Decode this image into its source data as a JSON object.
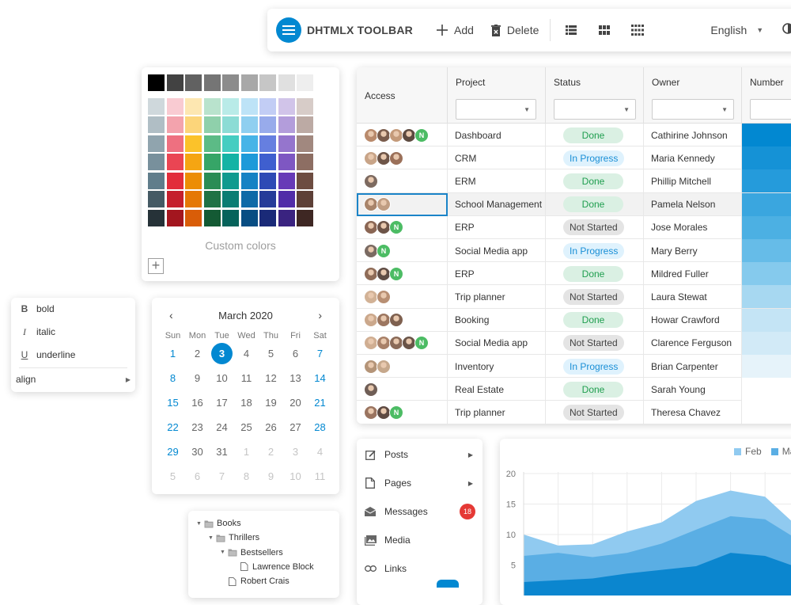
{
  "toolbar": {
    "title": "DHTMLX TOOLBAR",
    "add_label": "Add",
    "delete_label": "Delete",
    "language": "English"
  },
  "color_picker": {
    "grays": [
      "#000000",
      "#424242",
      "#616161",
      "#757575",
      "#8c8c8c",
      "#a8a8a8",
      "#c6c6c6",
      "#e0e0e0",
      "#eeeeee"
    ],
    "palette": [
      [
        "#cfd8dc",
        "#f9cbd2",
        "#fde7b1",
        "#b9e3cd",
        "#b9ebe8",
        "#bde3f7",
        "#c2cdf5",
        "#d1c4e9",
        "#d7ccc8"
      ],
      [
        "#b0bec5",
        "#f3a3ad",
        "#fcd57a",
        "#8fd0ab",
        "#8cdcd5",
        "#8fcff0",
        "#98abeb",
        "#b39ddb",
        "#bcaaa4"
      ],
      [
        "#90a4ae",
        "#ee7080",
        "#fbc22a",
        "#5cbb86",
        "#45cdc1",
        "#47b4e7",
        "#667fe0",
        "#9575cd",
        "#a1887f"
      ],
      [
        "#78909c",
        "#ea4553",
        "#f5a512",
        "#36a567",
        "#14b3a5",
        "#1e9ad9",
        "#3f5fcf",
        "#7e57c2",
        "#8d6e63"
      ],
      [
        "#607d8b",
        "#e22d3b",
        "#ec8d04",
        "#2a8c55",
        "#0f9a8e",
        "#1582c4",
        "#2e4ab5",
        "#673ab7",
        "#6d4c41"
      ],
      [
        "#455a64",
        "#c51f2d",
        "#e57805",
        "#1f7245",
        "#0a7d73",
        "#0e6aa7",
        "#263c99",
        "#512da8",
        "#5d4037"
      ],
      [
        "#263238",
        "#a3161f",
        "#d95d08",
        "#145a34",
        "#06635b",
        "#084d83",
        "#1a2a78",
        "#3a2380",
        "#3e2723"
      ]
    ],
    "custom_label": "Custom colors",
    "add_symbol": "+"
  },
  "menu": {
    "items": [
      {
        "icon": "B",
        "label": "bold"
      },
      {
        "icon": "I",
        "label": "italic"
      },
      {
        "icon": "U",
        "label": "underline"
      }
    ],
    "align_label": "align"
  },
  "calendar": {
    "month_label": "March 2020",
    "prev": "‹",
    "next": "›",
    "weekdays": [
      "Sun",
      "Mon",
      "Tue",
      "Wed",
      "Thu",
      "Fri",
      "Sat"
    ],
    "weeks": [
      [
        "1",
        "2",
        "3",
        "4",
        "5",
        "6",
        "7"
      ],
      [
        "8",
        "9",
        "10",
        "11",
        "12",
        "13",
        "14"
      ],
      [
        "15",
        "16",
        "17",
        "18",
        "19",
        "20",
        "21"
      ],
      [
        "22",
        "23",
        "24",
        "25",
        "26",
        "27",
        "28"
      ],
      [
        "29",
        "30",
        "31",
        "1",
        "2",
        "3",
        "4"
      ],
      [
        "5",
        "6",
        "7",
        "8",
        "9",
        "10",
        "11"
      ]
    ],
    "selected": "3"
  },
  "tree": {
    "items": [
      {
        "label": "Books",
        "type": "folder",
        "level": 0,
        "open": true
      },
      {
        "label": "Thrillers",
        "type": "folder",
        "level": 1,
        "open": true
      },
      {
        "label": "Bestsellers",
        "type": "folder",
        "level": 2,
        "open": true
      },
      {
        "label": "Lawrence Block",
        "type": "file",
        "level": 3
      },
      {
        "label": "Robert Crais",
        "type": "file",
        "level": 2
      }
    ]
  },
  "grid": {
    "columns": [
      "Access",
      "Project",
      "Status",
      "Owner",
      "Number"
    ],
    "rows": [
      {
        "avatars": [
          "#b98a6c",
          "#7a5c4c",
          "#c49a7a",
          "#5d4a40"
        ],
        "n": true,
        "project": "Dashboard",
        "status": "Done",
        "owner": "Cathirine Johnson",
        "number_color": "#0288d1"
      },
      {
        "avatars": [
          "#c8a488",
          "#6e5548",
          "#9b7059"
        ],
        "n": false,
        "project": "CRM",
        "status": "In Progress",
        "owner": "Maria Kennedy",
        "number_color": "#1592d6"
      },
      {
        "avatars": [
          "#7d6a60"
        ],
        "n": false,
        "project": "ERM",
        "status": "Done",
        "owner": "Phillip Mitchell",
        "number_color": "#259bdb"
      },
      {
        "avatars": [
          "#a8846a",
          "#c09d82"
        ],
        "n": false,
        "project": "School Management",
        "status": "Done",
        "owner": "Pamela Nelson",
        "number_color": "#3aa6df"
      },
      {
        "avatars": [
          "#8a6654",
          "#6d5448"
        ],
        "n": true,
        "project": "ERP",
        "status": "Not Started",
        "owner": "Jose Morales",
        "number_color": "#4cb0e3"
      },
      {
        "avatars": [
          "#7a6a62"
        ],
        "n": true,
        "project": "Social Media app",
        "status": "In Progress",
        "owner": "Mary Berry",
        "number_color": "#66bce8"
      },
      {
        "avatars": [
          "#8f6c58",
          "#5f4c44"
        ],
        "n": true,
        "project": "ERP",
        "status": "Done",
        "owner": "Mildred Fuller",
        "number_color": "#85caed"
      },
      {
        "avatars": [
          "#d2b296",
          "#b88f73"
        ],
        "n": false,
        "project": "Trip planner",
        "status": "Not Started",
        "owner": "Laura Stewat",
        "number_color": "#a7d8f1"
      },
      {
        "avatars": [
          "#cba88c",
          "#9c7660",
          "#7e604f"
        ],
        "n": false,
        "project": "Booking",
        "status": "Done",
        "owner": "Howar Crawford",
        "number_color": "#c4e4f5"
      },
      {
        "avatars": [
          "#d0ae92",
          "#a88068",
          "#8a6a58",
          "#6a5448"
        ],
        "n": true,
        "project": "Social Media app",
        "status": "Not Started",
        "owner": "Clarence Ferguson",
        "number_color": "#d2eaf7"
      },
      {
        "avatars": [
          "#b49478",
          "#c6a88c"
        ],
        "n": false,
        "project": "Inventory",
        "status": "In Progress",
        "owner": "Brian Carpenter",
        "number_color": "#e6f3fa"
      },
      {
        "avatars": [
          "#6f5e56"
        ],
        "n": false,
        "project": "Real Estate",
        "status": "Done",
        "owner": "Sarah Young",
        "number_color": "#ffffff"
      },
      {
        "avatars": [
          "#9a7460",
          "#5e4a42"
        ],
        "n": true,
        "project": "Trip planner",
        "status": "Not Started",
        "owner": "Theresa Chavez",
        "number_color": "#ffffff"
      }
    ],
    "n_label": "N"
  },
  "sidebar": {
    "items": [
      {
        "icon": "edit-icon",
        "label": "Posts",
        "arrow": true
      },
      {
        "icon": "page-icon",
        "label": "Pages",
        "arrow": true
      },
      {
        "icon": "message-icon",
        "label": "Messages",
        "count": "18"
      },
      {
        "icon": "image-icon",
        "label": "Media"
      },
      {
        "icon": "link-icon",
        "label": "Links"
      }
    ]
  },
  "chart_data": {
    "type": "area",
    "title": "",
    "ylim": [
      0,
      20
    ],
    "yticks": [
      "20",
      "15",
      "10",
      "5"
    ],
    "series": [
      {
        "name": "Feb",
        "color": "#90caf0",
        "values": [
          10,
          8.2,
          8.4,
          10.5,
          12,
          15.5,
          17.2,
          16.2,
          11
        ]
      },
      {
        "name": "Ma",
        "color": "#5aaee4",
        "values": [
          6.5,
          7,
          6.3,
          7,
          8.5,
          10.8,
          13,
          12.5,
          9
        ]
      },
      {
        "name": "",
        "color": "#0b86cf",
        "values": [
          2.2,
          2.5,
          2.8,
          3.6,
          4.2,
          4.8,
          7,
          6.5,
          4.5
        ]
      }
    ],
    "grid": true,
    "legend_position": "top-right"
  }
}
